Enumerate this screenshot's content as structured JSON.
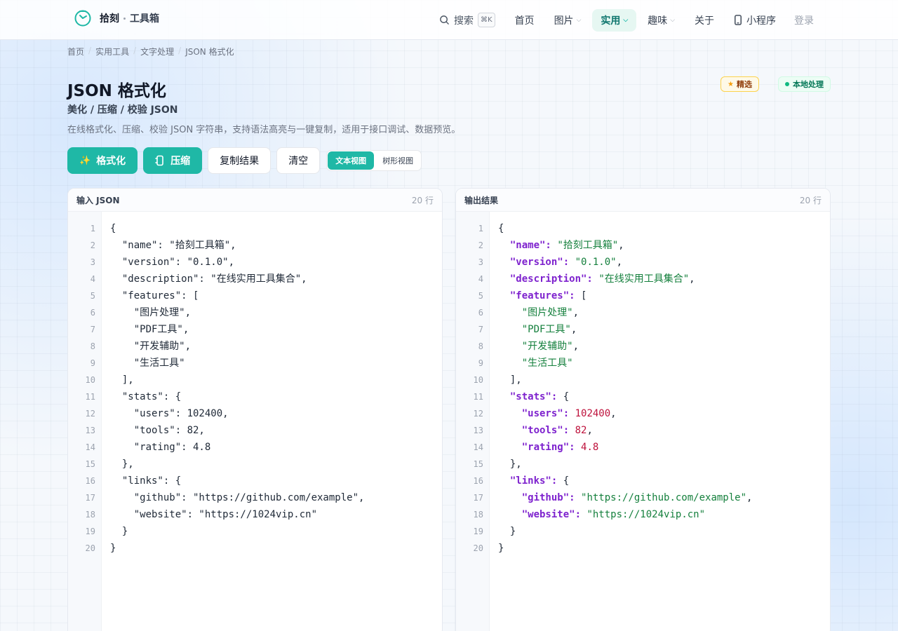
{
  "brand": {
    "name": "拾刻",
    "sub": "工具箱"
  },
  "nav": {
    "search_label": "搜索",
    "search_kbd": "⌘K",
    "items": [
      {
        "label": "首页",
        "dropdown": false
      },
      {
        "label": "图片",
        "dropdown": true
      },
      {
        "label": "实用",
        "dropdown": true,
        "active": true
      },
      {
        "label": "趣味",
        "dropdown": true
      },
      {
        "label": "关于",
        "dropdown": false
      }
    ],
    "mini_program": "小程序",
    "login": "登录"
  },
  "breadcrumb": [
    "首页",
    "实用工具",
    "文字处理",
    "JSON 格式化"
  ],
  "header": {
    "title": "JSON 格式化",
    "subtitle": "美化 / 压缩 / 校验 JSON",
    "description": "在线格式化、压缩、校验 JSON 字符串，支持语法高亮与一键复制，适用于接口调试、数据预览。",
    "badge_featured": "精选",
    "badge_local": "本地处理"
  },
  "toolbar": {
    "format": "格式化",
    "compress": "压缩",
    "copy": "复制结果",
    "clear": "清空",
    "view_text": "文本视图",
    "view_tree": "树形视图"
  },
  "input_panel": {
    "title": "输入 JSON",
    "count": "20 行"
  },
  "output_panel": {
    "title": "输出结果",
    "count": "20 行"
  },
  "input_lines": [
    "{",
    "  \"name\": \"拾刻工具箱\",",
    "  \"version\": \"0.1.0\",",
    "  \"description\": \"在线实用工具集合\",",
    "  \"features\": [",
    "    \"图片处理\",",
    "    \"PDF工具\",",
    "    \"开发辅助\",",
    "    \"生活工具\"",
    "  ],",
    "  \"stats\": {",
    "    \"users\": 102400,",
    "    \"tools\": 82,",
    "    \"rating\": 4.8",
    "  },",
    "  \"links\": {",
    "    \"github\": \"https://github.com/example\",",
    "    \"website\": \"https://1024vip.cn\"",
    "  }",
    "}"
  ],
  "output_tokens": [
    [
      [
        "p",
        "{"
      ]
    ],
    [
      [
        "p",
        "  "
      ],
      [
        "k",
        "\"name\":"
      ],
      [
        "p",
        " "
      ],
      [
        "s",
        "\"拾刻工具箱\""
      ],
      [
        "p",
        ","
      ]
    ],
    [
      [
        "p",
        "  "
      ],
      [
        "k",
        "\"version\":"
      ],
      [
        "p",
        " "
      ],
      [
        "s",
        "\"0.1.0\""
      ],
      [
        "p",
        ","
      ]
    ],
    [
      [
        "p",
        "  "
      ],
      [
        "k",
        "\"description\":"
      ],
      [
        "p",
        " "
      ],
      [
        "s",
        "\"在线实用工具集合\""
      ],
      [
        "p",
        ","
      ]
    ],
    [
      [
        "p",
        "  "
      ],
      [
        "k",
        "\"features\":"
      ],
      [
        "p",
        " ["
      ]
    ],
    [
      [
        "p",
        "    "
      ],
      [
        "s",
        "\"图片处理\""
      ],
      [
        "p",
        ","
      ]
    ],
    [
      [
        "p",
        "    "
      ],
      [
        "s",
        "\"PDF工具\""
      ],
      [
        "p",
        ","
      ]
    ],
    [
      [
        "p",
        "    "
      ],
      [
        "s",
        "\"开发辅助\""
      ],
      [
        "p",
        ","
      ]
    ],
    [
      [
        "p",
        "    "
      ],
      [
        "s",
        "\"生活工具\""
      ]
    ],
    [
      [
        "p",
        "  ],"
      ]
    ],
    [
      [
        "p",
        "  "
      ],
      [
        "k",
        "\"stats\":"
      ],
      [
        "p",
        " {"
      ]
    ],
    [
      [
        "p",
        "    "
      ],
      [
        "k",
        "\"users\":"
      ],
      [
        "p",
        " "
      ],
      [
        "n",
        "102400"
      ],
      [
        "p",
        ","
      ]
    ],
    [
      [
        "p",
        "    "
      ],
      [
        "k",
        "\"tools\":"
      ],
      [
        "p",
        " "
      ],
      [
        "n",
        "82"
      ],
      [
        "p",
        ","
      ]
    ],
    [
      [
        "p",
        "    "
      ],
      [
        "k",
        "\"rating\":"
      ],
      [
        "p",
        " "
      ],
      [
        "n",
        "4.8"
      ]
    ],
    [
      [
        "p",
        "  },"
      ]
    ],
    [
      [
        "p",
        "  "
      ],
      [
        "k",
        "\"links\":"
      ],
      [
        "p",
        " {"
      ]
    ],
    [
      [
        "p",
        "    "
      ],
      [
        "k",
        "\"github\":"
      ],
      [
        "p",
        " "
      ],
      [
        "s",
        "\"https://github.com/example\""
      ],
      [
        "p",
        ","
      ]
    ],
    [
      [
        "p",
        "    "
      ],
      [
        "k",
        "\"website\":"
      ],
      [
        "p",
        " "
      ],
      [
        "s",
        "\"https://1024vip.cn\""
      ]
    ],
    [
      [
        "p",
        "  }"
      ]
    ],
    [
      [
        "p",
        "}"
      ]
    ]
  ]
}
